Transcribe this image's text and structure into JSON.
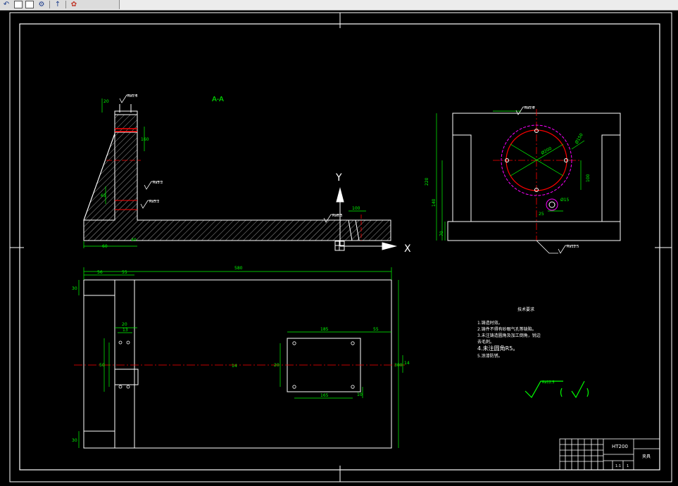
{
  "toolbar": {
    "icons": [
      "undo-icon",
      "open-file-icon",
      "save-icon",
      "settings-gear-icon",
      "pointer-icon",
      "app-logo-icon"
    ]
  },
  "drawing": {
    "section_label": "A-A",
    "axis_y_label": "Y",
    "axis_x_label": "X",
    "roughness_labels": [
      "Ra1.6",
      "Ra3.2",
      "Ra3.2",
      "Ra6.3",
      "Ra1.6",
      "Ra12.5",
      "Ra12.5"
    ],
    "dims_side": [
      "60",
      "160",
      "20",
      "65",
      "100",
      "40"
    ],
    "dims_plan": {
      "top_left_1": "56",
      "top_left_2": "55",
      "overall_length": "580",
      "left_height": "30",
      "bottom_height": "30",
      "right_total": "300",
      "right_total_2": "14",
      "hole_w1": "20",
      "hole_w2": "13",
      "center_left": "50",
      "center_mid": "14",
      "pad_top": "185",
      "pad_right": "55",
      "pad_bottom": "165",
      "pad_side": "20",
      "pad_side_r": "10"
    },
    "dims_right": {
      "overall_h": "220",
      "mid_h": "140",
      "base_h": "70",
      "circle_d": "Ø200",
      "bolt_d": "Ø150",
      "hole_d": "Ø15",
      "offset": "25",
      "radius": "100"
    },
    "notes": {
      "title": "技术要求",
      "lines": [
        "1.铸造时效。",
        "2.铸件不得有砂眼气孔等缺陷。",
        "3.未注铸造圆角及加工倒角，锐边",
        "去毛刺。",
        "4.未注圆角R5。",
        "5.涂漆防锈。"
      ]
    },
    "title_block": {
      "material": "HT200",
      "part_name": "夹具",
      "scale": "1:1",
      "sheet": "1"
    }
  },
  "colors": {
    "background": "#000000",
    "outline": "#ffffff",
    "dimension": "#00ff00",
    "centerline": "#ff0000",
    "hidden_circle": "#ff00ff"
  }
}
